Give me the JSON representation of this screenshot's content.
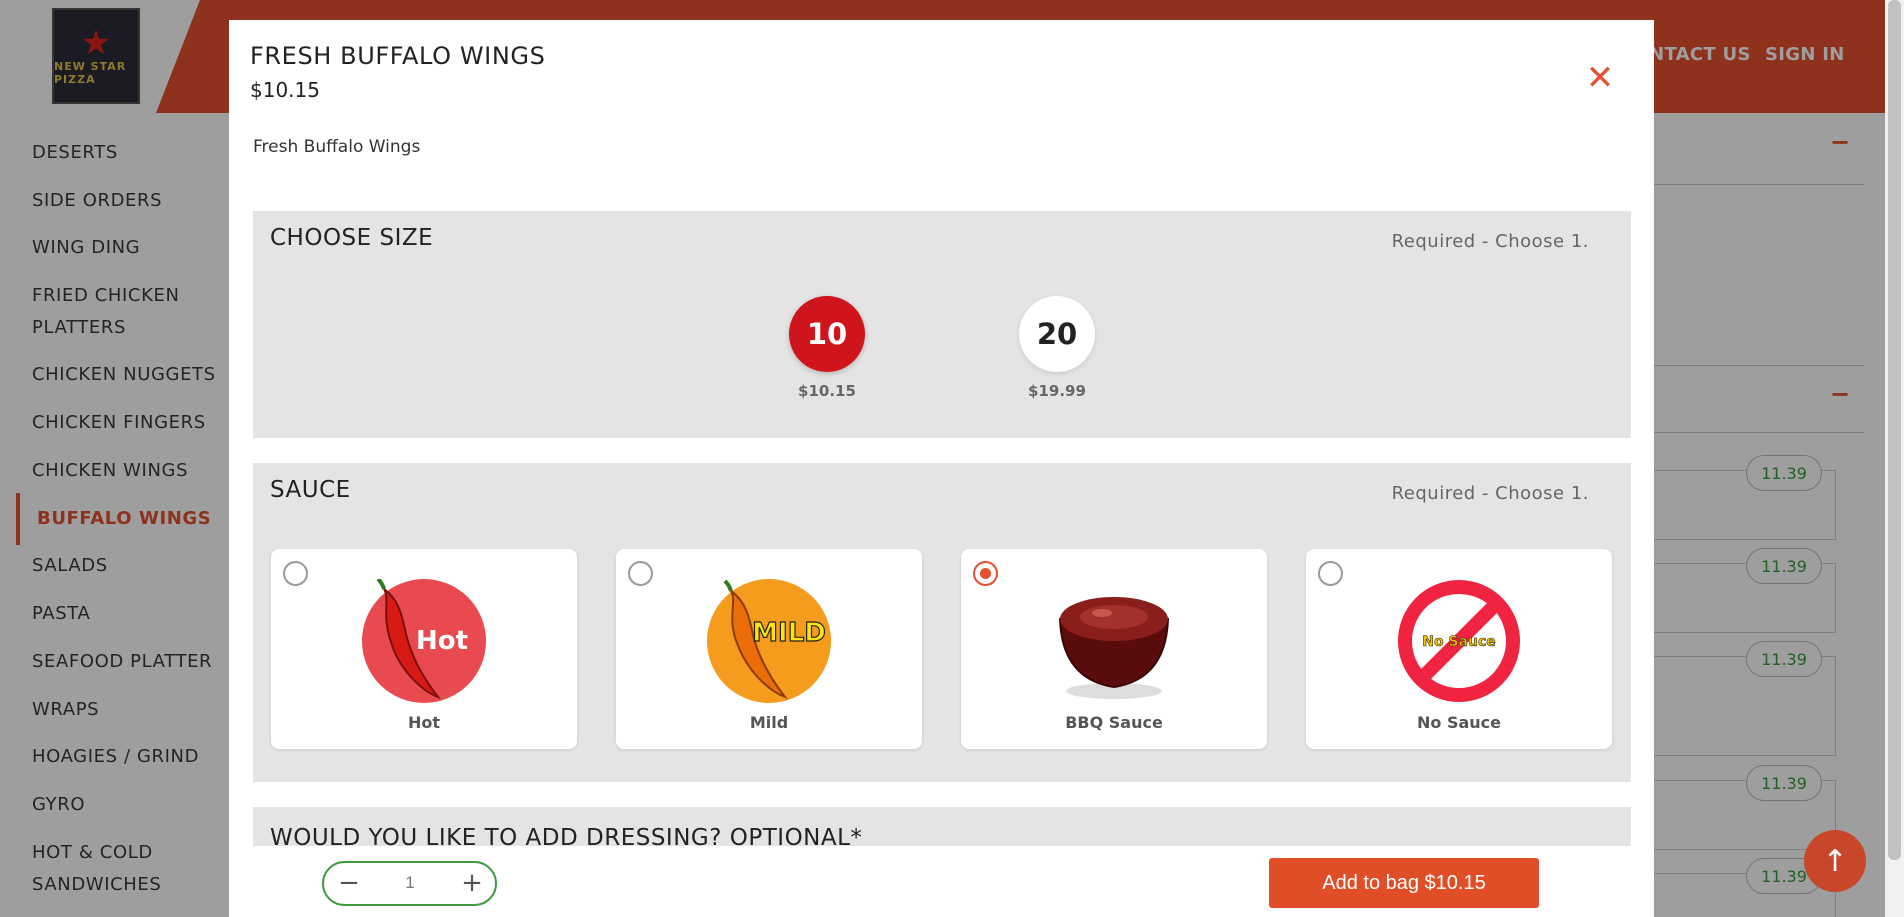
{
  "header": {
    "logo_text": "NEW STAR PIZZA",
    "nav": [
      "CONTACT US",
      "SIGN IN"
    ]
  },
  "sidebar": {
    "items": [
      {
        "label": "DESERTS",
        "active": false
      },
      {
        "label": "SIDE ORDERS",
        "active": false
      },
      {
        "label": "WING DING",
        "active": false
      },
      {
        "label": "FRIED CHICKEN PLATTERS",
        "active": false
      },
      {
        "label": "CHICKEN NUGGETS",
        "active": false
      },
      {
        "label": "CHICKEN FINGERS",
        "active": false
      },
      {
        "label": "CHICKEN WINGS",
        "active": false
      },
      {
        "label": "BUFFALO WINGS",
        "active": true
      },
      {
        "label": "SALADS",
        "active": false
      },
      {
        "label": "PASTA",
        "active": false
      },
      {
        "label": "SEAFOOD PLATTER",
        "active": false
      },
      {
        "label": "WRAPS",
        "active": false
      },
      {
        "label": "HOAGIES / GRIND",
        "active": false
      },
      {
        "label": "GYRO",
        "active": false
      },
      {
        "label": "HOT & COLD SANDWICHES",
        "active": false
      }
    ]
  },
  "background_list": {
    "collapse_icons": [
      "−",
      "−"
    ],
    "prices": [
      "11.39",
      "11.39",
      "11.39",
      "11.39",
      "11.39"
    ]
  },
  "modal": {
    "title": "FRESH BUFFALO WINGS",
    "price": "$10.15",
    "close_icon": "close-icon",
    "description": "Fresh Buffalo Wings",
    "size": {
      "title": "CHOOSE SIZE",
      "requirement": "Required - Choose 1.",
      "options": [
        {
          "label": "10",
          "price": "$10.15",
          "selected": true
        },
        {
          "label": "20",
          "price": "$19.99",
          "selected": false
        }
      ]
    },
    "sauce": {
      "title": "SAUCE",
      "requirement": "Required - Choose 1.",
      "options": [
        {
          "label": "Hot",
          "image_text": "Hot",
          "selected": false
        },
        {
          "label": "Mild",
          "image_text": "MILD",
          "selected": false
        },
        {
          "label": "BBQ Sauce",
          "image_text": "",
          "selected": true
        },
        {
          "label": "No Sauce",
          "image_text": "No Sauce",
          "selected": false
        }
      ]
    },
    "dressing": {
      "title": "WOULD YOU LIKE TO ADD DRESSING? OPTIONAL*"
    },
    "footer": {
      "qty_minus": "−",
      "qty_value": "1",
      "qty_plus": "+",
      "add_button": "Add to bag $10.15"
    }
  },
  "colors": {
    "brand": "#e64f30",
    "size_selected": "#d0141b",
    "qty_border": "#3f9a3f",
    "price_green": "#3a9a3a"
  },
  "scroll_top_icon": "arrow-up-icon"
}
